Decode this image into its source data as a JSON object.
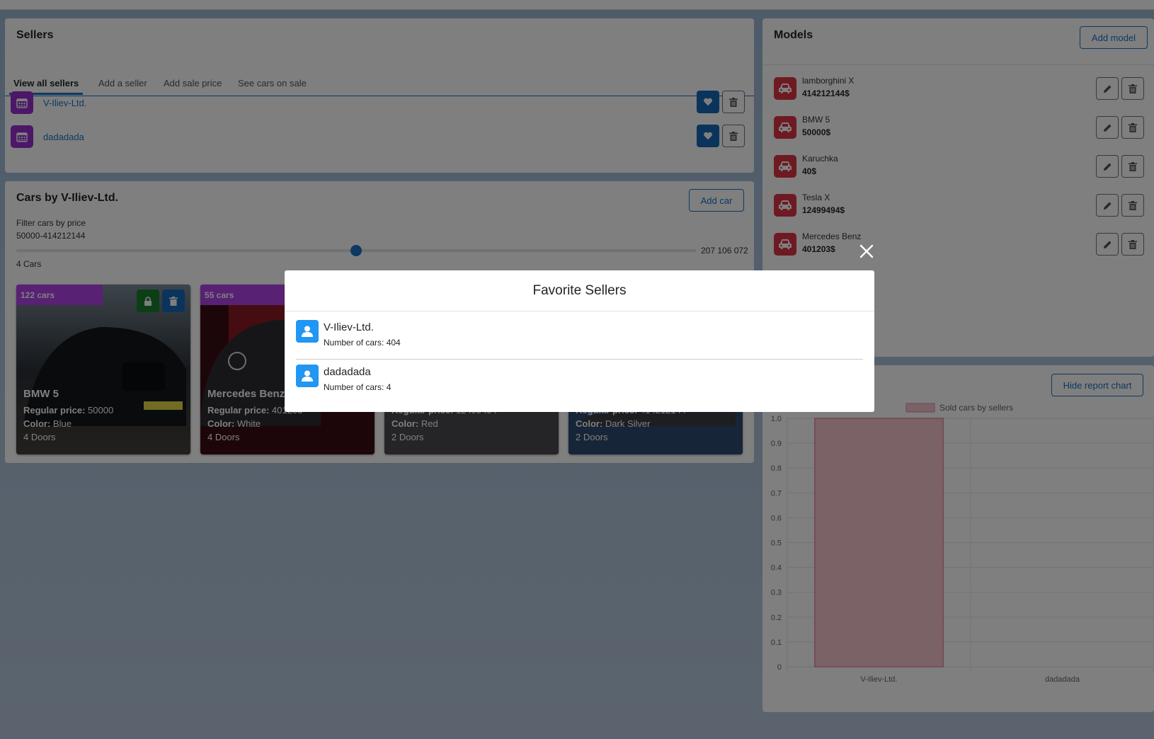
{
  "sellers": {
    "title": "Sellers",
    "tabs": [
      "View all sellers",
      "Add a seller",
      "Add sale price",
      "See cars on sale"
    ],
    "items": [
      {
        "name": "V-Iliev-Ltd."
      },
      {
        "name": "dadadada"
      }
    ]
  },
  "cars": {
    "title": "Cars by V-Iliev-Ltd.",
    "add_label": "Add car",
    "filter_label": "Filter cars by price",
    "filter_range": "50000-414212144",
    "slider_value": "207 106 072",
    "slider_fraction": 0.5,
    "count": "4 Cars",
    "price_label": "Regular price:",
    "color_label": "Color:",
    "cards": [
      {
        "badge": "122 cars",
        "name": "BMW 5",
        "price": "50000",
        "color": "Blue",
        "doors": "4 Doors"
      },
      {
        "badge": "55 cars",
        "name": "Mercedes Benz",
        "price": "401203",
        "color": "White",
        "doors": "4 Doors"
      },
      {
        "badge": "",
        "name": "",
        "price": "12499494",
        "color": "Red",
        "doors": "2 Doors"
      },
      {
        "badge": "",
        "name": "",
        "price": "414212144",
        "color": "Dark Silver",
        "doors": "2 Doors"
      }
    ]
  },
  "models": {
    "title": "Models",
    "add_label": "Add model",
    "items": [
      {
        "name": "lamborghini X",
        "price": "414212144$"
      },
      {
        "name": "BMW 5",
        "price": "50000$"
      },
      {
        "name": "Karuchka",
        "price": "40$"
      },
      {
        "name": "Tesla X",
        "price": "12499494$"
      },
      {
        "name": "Mercedes Benz",
        "price": "401203$"
      }
    ]
  },
  "report": {
    "hide_label": "Hide report chart"
  },
  "chart_data": {
    "type": "bar",
    "categories": [
      "V-Iliev-Ltd.",
      "dadadada"
    ],
    "series": [
      {
        "name": "Sold cars by sellers",
        "values": [
          1.0,
          0
        ]
      }
    ],
    "ylim": [
      0,
      1.0
    ],
    "yticks": [
      "1.0",
      "0.9",
      "0.8",
      "0.7",
      "0.6",
      "0.5",
      "0.4",
      "0.3",
      "0.2",
      "0.1",
      "0"
    ],
    "legend": "top",
    "grid": true,
    "colors": {
      "bar_fill": "#f6c4cf",
      "bar_stroke": "#e58aa0"
    }
  },
  "modal": {
    "title": "Favorite Sellers",
    "count_prefix": "Number of cars:",
    "items": [
      {
        "name": "V-Iliev-Ltd.",
        "count": "404"
      },
      {
        "name": "dadadada",
        "count": "4"
      }
    ]
  },
  "colors": {
    "primary": "#1a73c4",
    "seller_badge": "#9b2fcf",
    "model_badge": "#dc3545",
    "cars_badge": "#b043e6"
  }
}
